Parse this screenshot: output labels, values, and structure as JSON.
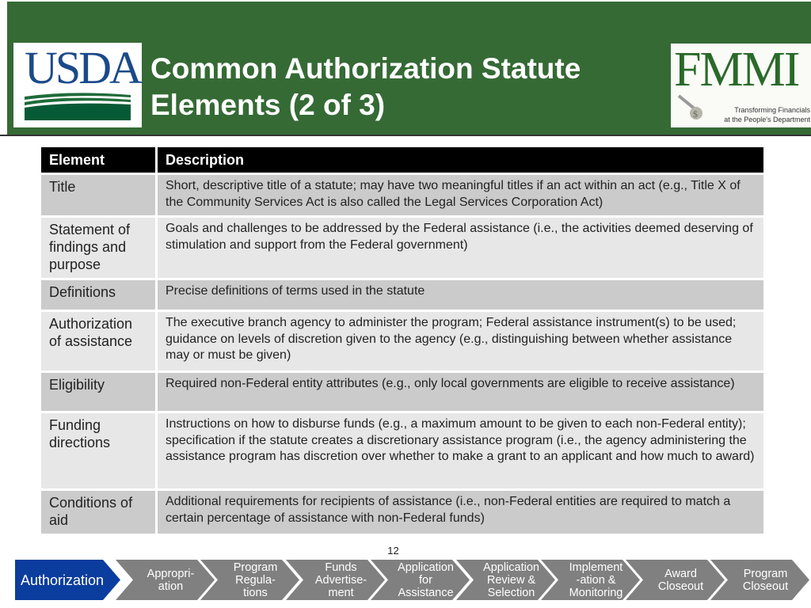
{
  "header": {
    "title_line1": "Common Authorization Statute",
    "title_line2": "Elements (2 of 3)",
    "left_logo_text": "USDA",
    "right_logo_text": "FMMI",
    "right_logo_tagline_line1": "Transforming Financials",
    "right_logo_tagline_line2": "at the People's Department"
  },
  "table": {
    "columns": [
      "Element",
      "Description"
    ],
    "rows": [
      {
        "element": "Title",
        "description": "Short, descriptive title of a statute; may have two meaningful titles if an act within an act (e.g., Title X of the Community Services Act is also called the Legal Services Corporation Act)"
      },
      {
        "element": "Statement of findings and purpose",
        "description": "Goals and challenges to be addressed by the Federal assistance (i.e., the activities deemed deserving of stimulation and support from the Federal government)"
      },
      {
        "element": "Definitions",
        "description": "Precise definitions of terms used in the statute"
      },
      {
        "element": "Authorization of assistance",
        "description": "The executive branch agency to administer the program; Federal assistance instrument(s) to be used; guidance on levels of discretion given to the agency (e.g., distinguishing between whether assistance may or must be given)"
      },
      {
        "element": "Eligibility",
        "description": "Required non-Federal entity attributes (e.g., only local governments are eligible to receive assistance)"
      },
      {
        "element": "Funding directions",
        "description": "Instructions on how to disburse funds (e.g., a maximum amount to be given to each non-Federal entity); specification if the statute creates a discretionary assistance program (i.e., the agency administering the assistance program has discretion over whether to make a grant to an applicant and how much to award)"
      },
      {
        "element": "Conditions of aid",
        "description": "Additional requirements for recipients of assistance (i.e., non-Federal entities are required to match a certain percentage of assistance with non-Federal funds)"
      }
    ]
  },
  "page_number": "12",
  "process": {
    "active_color": "#0b3d9e",
    "inactive_color": "#808080",
    "steps": [
      {
        "label": "Authorization",
        "active": true
      },
      {
        "label": "Appropri-\nation",
        "active": false
      },
      {
        "label": "Program\nRegula-\ntions",
        "active": false
      },
      {
        "label": "Funds\nAdvertise-\nment",
        "active": false
      },
      {
        "label": "Application\nfor\nAssistance",
        "active": false
      },
      {
        "label": "Application\nReview &\nSelection",
        "active": false
      },
      {
        "label": "Implement\n-ation &\nMonitoring",
        "active": false
      },
      {
        "label": "Award\nCloseout",
        "active": false
      },
      {
        "label": "Program\nCloseout",
        "active": false
      }
    ]
  },
  "colors": {
    "header_green": "#356a35",
    "table_header": "#000000",
    "row_dark": "#cbcbcb",
    "row_light": "#e7e7e7"
  }
}
